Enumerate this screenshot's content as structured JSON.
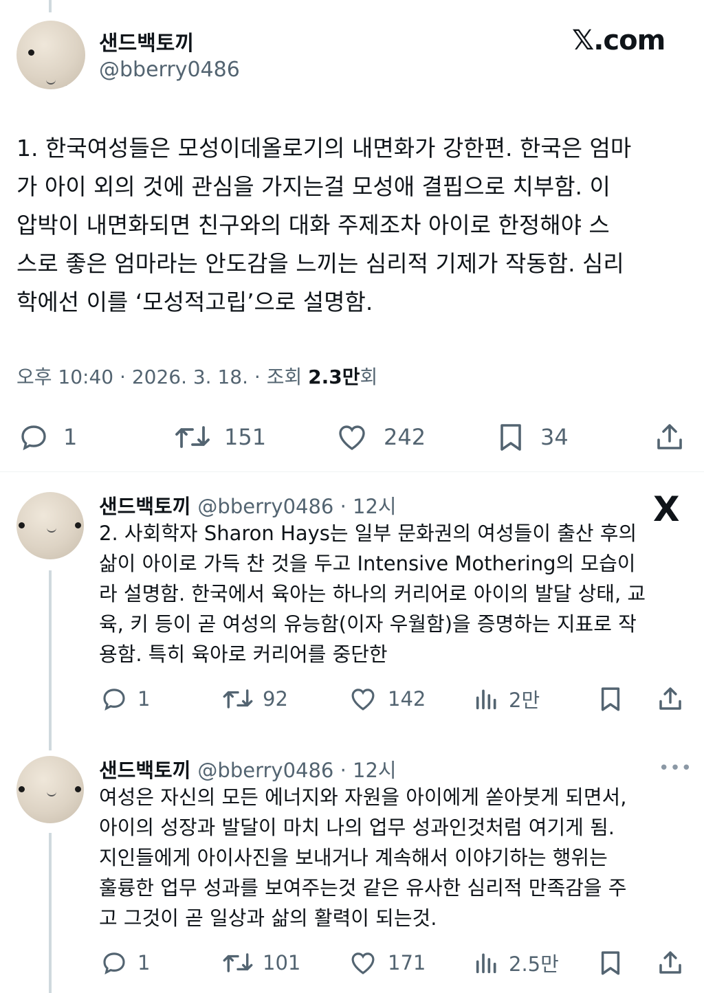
{
  "main": {
    "name": "샌드백토끼",
    "handle": "@bberry0486",
    "site": "𝕏.com",
    "lines": [
      "1. 한국여성들은 모성이데올로기의 내면화가 강한편. 한국은 엄마",
      "가 아이 외의 것에 관심을 가지는걸 모성애 결핍으로 치부함. 이",
      "압박이 내면화되면 친구와의 대화 주제조차 아이로 한정해야 스",
      "스로 좋은 엄마라는 안도감을 느끼는 심리적 기제가 작동함. 심리",
      "학에선 이를 ‘모성적고립’으로 설명함."
    ],
    "time": "오후 10:40 · 2026. 3. 18. · 조회 ",
    "views": "2.3만",
    "views_suffix": "회",
    "replies": "1",
    "reposts": "151",
    "likes": "242",
    "bookmarks": "34"
  },
  "reply1": {
    "name": "샌드백토끼",
    "handle": "@bberry0486 · 12시",
    "close_glyph": "X",
    "lines": [
      "2. 사회학자 Sharon Hays는 일부 문화권의 여성들이 출산 후의",
      "삶이 아이로 가득 찬 것을 두고 Intensive Mothering의 모습이",
      "라 설명함. 한국에서 육아는 하나의 커리어로 아이의 발달 상태, 교",
      "육, 키 등이 곧 여성의 유능함(이자 우월함)을 증명하는 지표로 작",
      "용함. 특히 육아로 커리어를 중단한"
    ],
    "replies": "1",
    "reposts": "92",
    "likes": "142",
    "views": "2만"
  },
  "reply2": {
    "name": "샌드백토끼",
    "handle": "@bberry0486 · 12시",
    "more": "•••",
    "lines": [
      "여성은 자신의 모든 에너지와 자원을 아이에게 쏟아붓게 되면서,",
      "아이의 성장과 발달이 마치 나의 업무 성과인것처럼 여기게 됨.",
      "지인들에게 아이사진을 보내거나 계속해서 이야기하는 행위는",
      "훌륭한 업무 성과를 보여주는것 같은 유사한 심리적 만족감을 주",
      "고 그것이 곧 일상과 삶의 활력이 되는것."
    ],
    "replies": "1",
    "reposts": "101",
    "likes": "171",
    "views": "2.5만"
  },
  "colors": {
    "text": "#0f1419",
    "secondary": "#536471",
    "thread": "#cfd9de"
  }
}
